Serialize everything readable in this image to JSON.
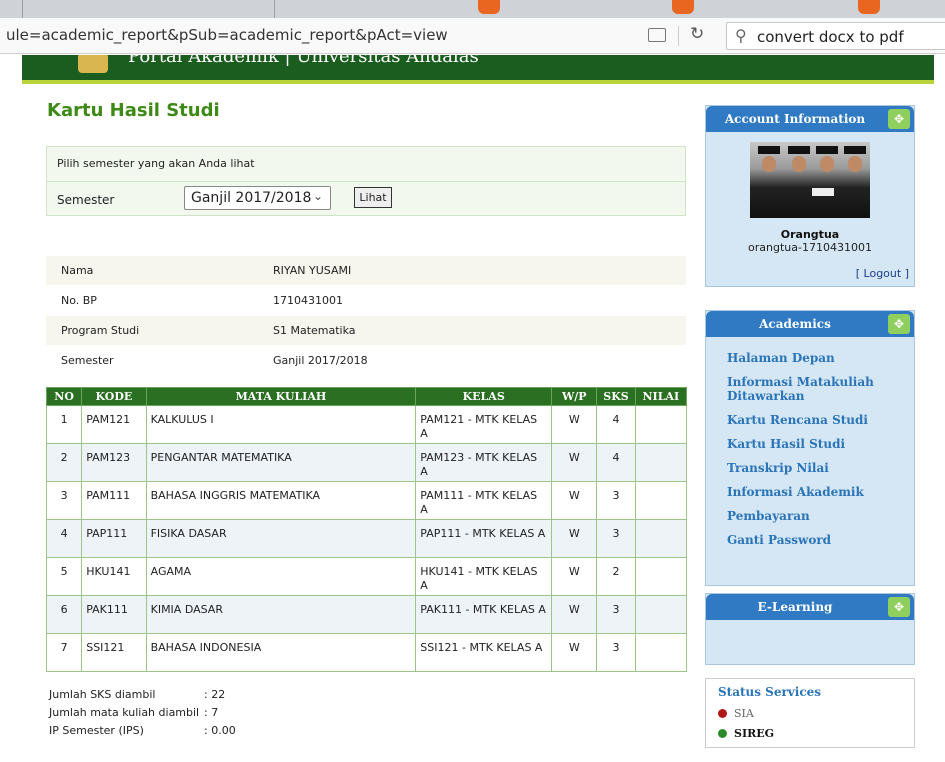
{
  "browser": {
    "url": "ule=academic_report&pSub=academic_report&pAct=view",
    "search_query": "convert docx to pdf"
  },
  "header": {
    "portal_title": "Portal Akademik  |  Universitas Andalas"
  },
  "page_title": "Kartu Hasil Studi",
  "semester_form": {
    "prompt": "Pilih semester yang akan Anda lihat",
    "label": "Semester",
    "selected": "Ganjil 2017/2018",
    "button": "Lihat"
  },
  "student": [
    {
      "label": "Nama",
      "value": "RIYAN YUSAMI"
    },
    {
      "label": "No. BP",
      "value": "1710431001"
    },
    {
      "label": "Program Studi",
      "value": "S1 Matematika"
    },
    {
      "label": "Semester",
      "value": "Ganjil 2017/2018"
    }
  ],
  "table": {
    "headers": [
      "NO",
      "KODE",
      "MATA KULIAH",
      "KELAS",
      "W/P",
      "SKS",
      "NILAI"
    ],
    "rows": [
      {
        "no": "1",
        "kode": "PAM121",
        "mk": "KALKULUS I",
        "kelas": "PAM121 - MTK KELAS A",
        "wp": "W",
        "sks": "4",
        "nilai": ""
      },
      {
        "no": "2",
        "kode": "PAM123",
        "mk": "PENGANTAR MATEMATIKA",
        "kelas": "PAM123 - MTK KELAS A",
        "wp": "W",
        "sks": "4",
        "nilai": ""
      },
      {
        "no": "3",
        "kode": "PAM111",
        "mk": "BAHASA INGGRIS MATEMATIKA",
        "kelas": "PAM111 - MTK KELAS A",
        "wp": "W",
        "sks": "3",
        "nilai": ""
      },
      {
        "no": "4",
        "kode": "PAP111",
        "mk": "FISIKA DASAR",
        "kelas": "PAP111 - MTK KELAS A",
        "wp": "W",
        "sks": "3",
        "nilai": ""
      },
      {
        "no": "5",
        "kode": "HKU141",
        "mk": "AGAMA",
        "kelas": "HKU141 - MTK KELAS A",
        "wp": "W",
        "sks": "2",
        "nilai": ""
      },
      {
        "no": "6",
        "kode": "PAK111",
        "mk": "KIMIA DASAR",
        "kelas": "PAK111 - MTK KELAS A",
        "wp": "W",
        "sks": "3",
        "nilai": ""
      },
      {
        "no": "7",
        "kode": "SSI121",
        "mk": "BAHASA INDONESIA",
        "kelas": "SSI121 - MTK KELAS A",
        "wp": "W",
        "sks": "3",
        "nilai": ""
      }
    ]
  },
  "summary": [
    {
      "label": "Jumlah SKS diambil",
      "value": ": 22"
    },
    {
      "label": "Jumlah mata kuliah diambil",
      "value": ": 7"
    },
    {
      "label": "IP Semester (IPS)",
      "value": ": 0.00"
    }
  ],
  "account": {
    "title": "Account Information",
    "name": "Orangtua",
    "id": "orangtua-1710431001",
    "logout": "[ Logout ]"
  },
  "academics": {
    "title": "Academics",
    "items": [
      "Halaman Depan",
      "Informasi Matakuliah Ditawarkan",
      "Kartu Rencana Studi",
      "Kartu Hasil Studi",
      "Transkrip Nilai",
      "Informasi Akademik",
      "Pembayaran",
      "Ganti Password"
    ]
  },
  "elearning": {
    "title": "E-Learning"
  },
  "status_services": {
    "title": "Status Services",
    "items": [
      {
        "name": "SIA",
        "color": "#b01717"
      },
      {
        "name": "SIREG",
        "color": "#2a8a2a"
      }
    ]
  },
  "colors": {
    "header_green": "#1b5d1e",
    "accent_lime": "#b9d33a",
    "title_green": "#3e8a16",
    "sidebar_blue": "#2f7ac2",
    "link_blue": "#2a74b8"
  }
}
